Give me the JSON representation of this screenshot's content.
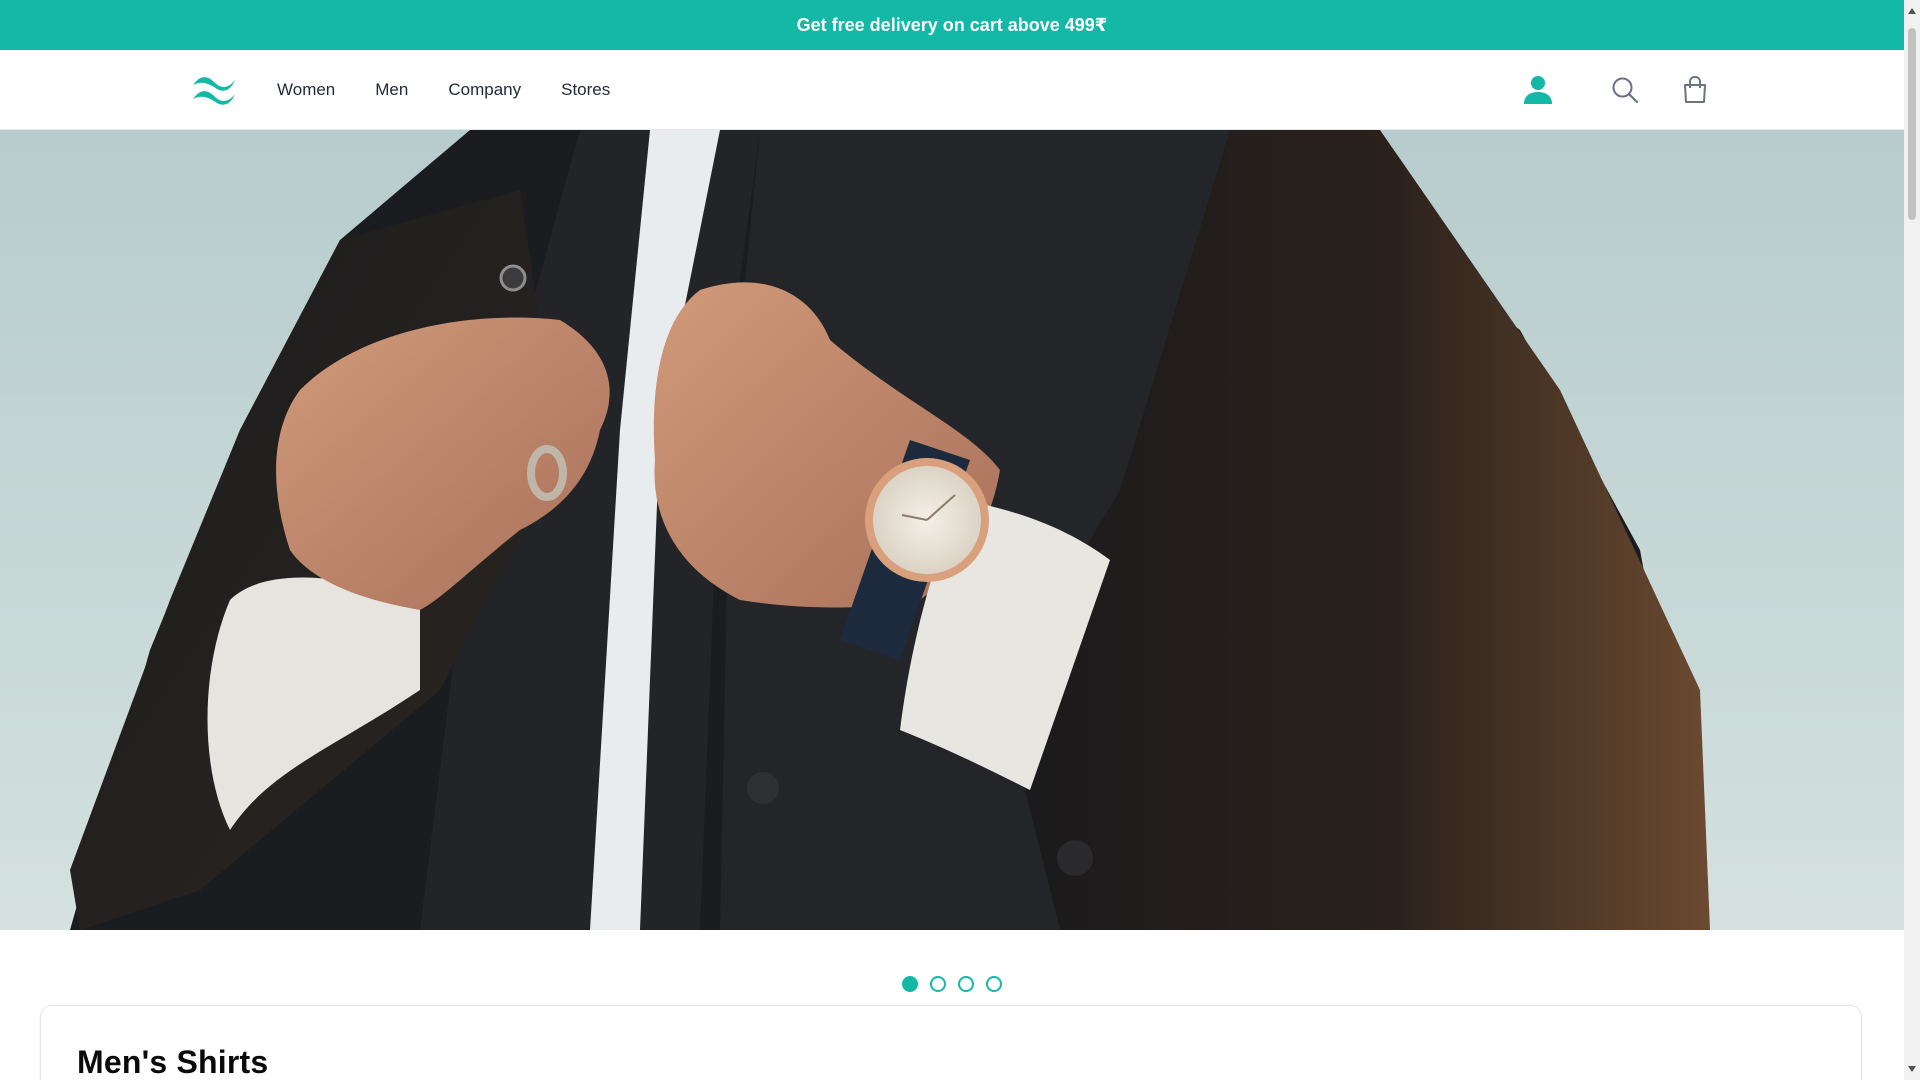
{
  "announcement": {
    "text": "Get free delivery on cart above 499₹"
  },
  "header": {
    "logo_icon": "tailwind-wave-logo",
    "nav": [
      {
        "label": "Women"
      },
      {
        "label": "Men"
      },
      {
        "label": "Company"
      },
      {
        "label": "Stores"
      }
    ],
    "actions": {
      "account_icon": "user-icon",
      "search_icon": "search-icon",
      "cart_icon": "shopping-bag-icon"
    }
  },
  "hero": {
    "image_subject": "man in dark jacket wearing a wristwatch",
    "carousel": {
      "count": 4,
      "active_index": 0
    }
  },
  "section": {
    "title": "Men's Shirts"
  },
  "colors": {
    "accent": "#14b8a6",
    "text": "#1f2937",
    "heading": "#0a0a0a"
  }
}
